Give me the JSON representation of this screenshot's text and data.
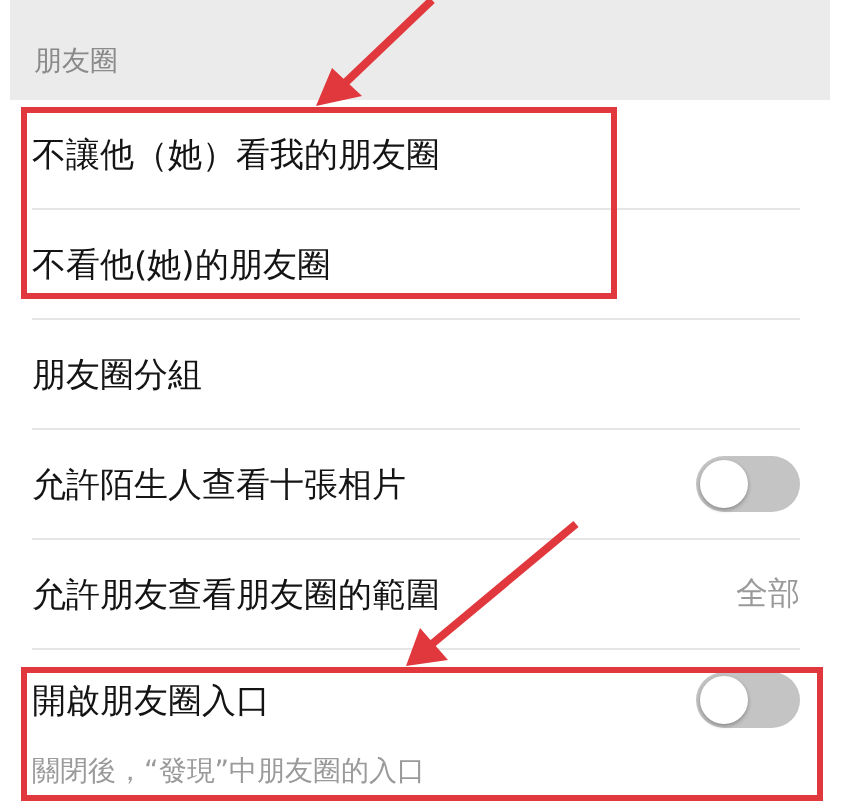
{
  "section_header": "朋友圈",
  "rows": [
    {
      "kind": "link",
      "label": "不讓他（她）看我的朋友圈"
    },
    {
      "kind": "link",
      "label": "不看他(她)的朋友圈"
    },
    {
      "kind": "link",
      "label": "朋友圈分組"
    },
    {
      "kind": "switch",
      "label": "允許陌生人查看十張相片",
      "on": false
    },
    {
      "kind": "value",
      "label": "允許朋友查看朋友圈的範圍",
      "value": "全部"
    },
    {
      "kind": "switch",
      "label": "開啟朋友圈入口",
      "on": false
    }
  ],
  "footer_note": "關閉後，“發現”中朋友圈的入口"
}
